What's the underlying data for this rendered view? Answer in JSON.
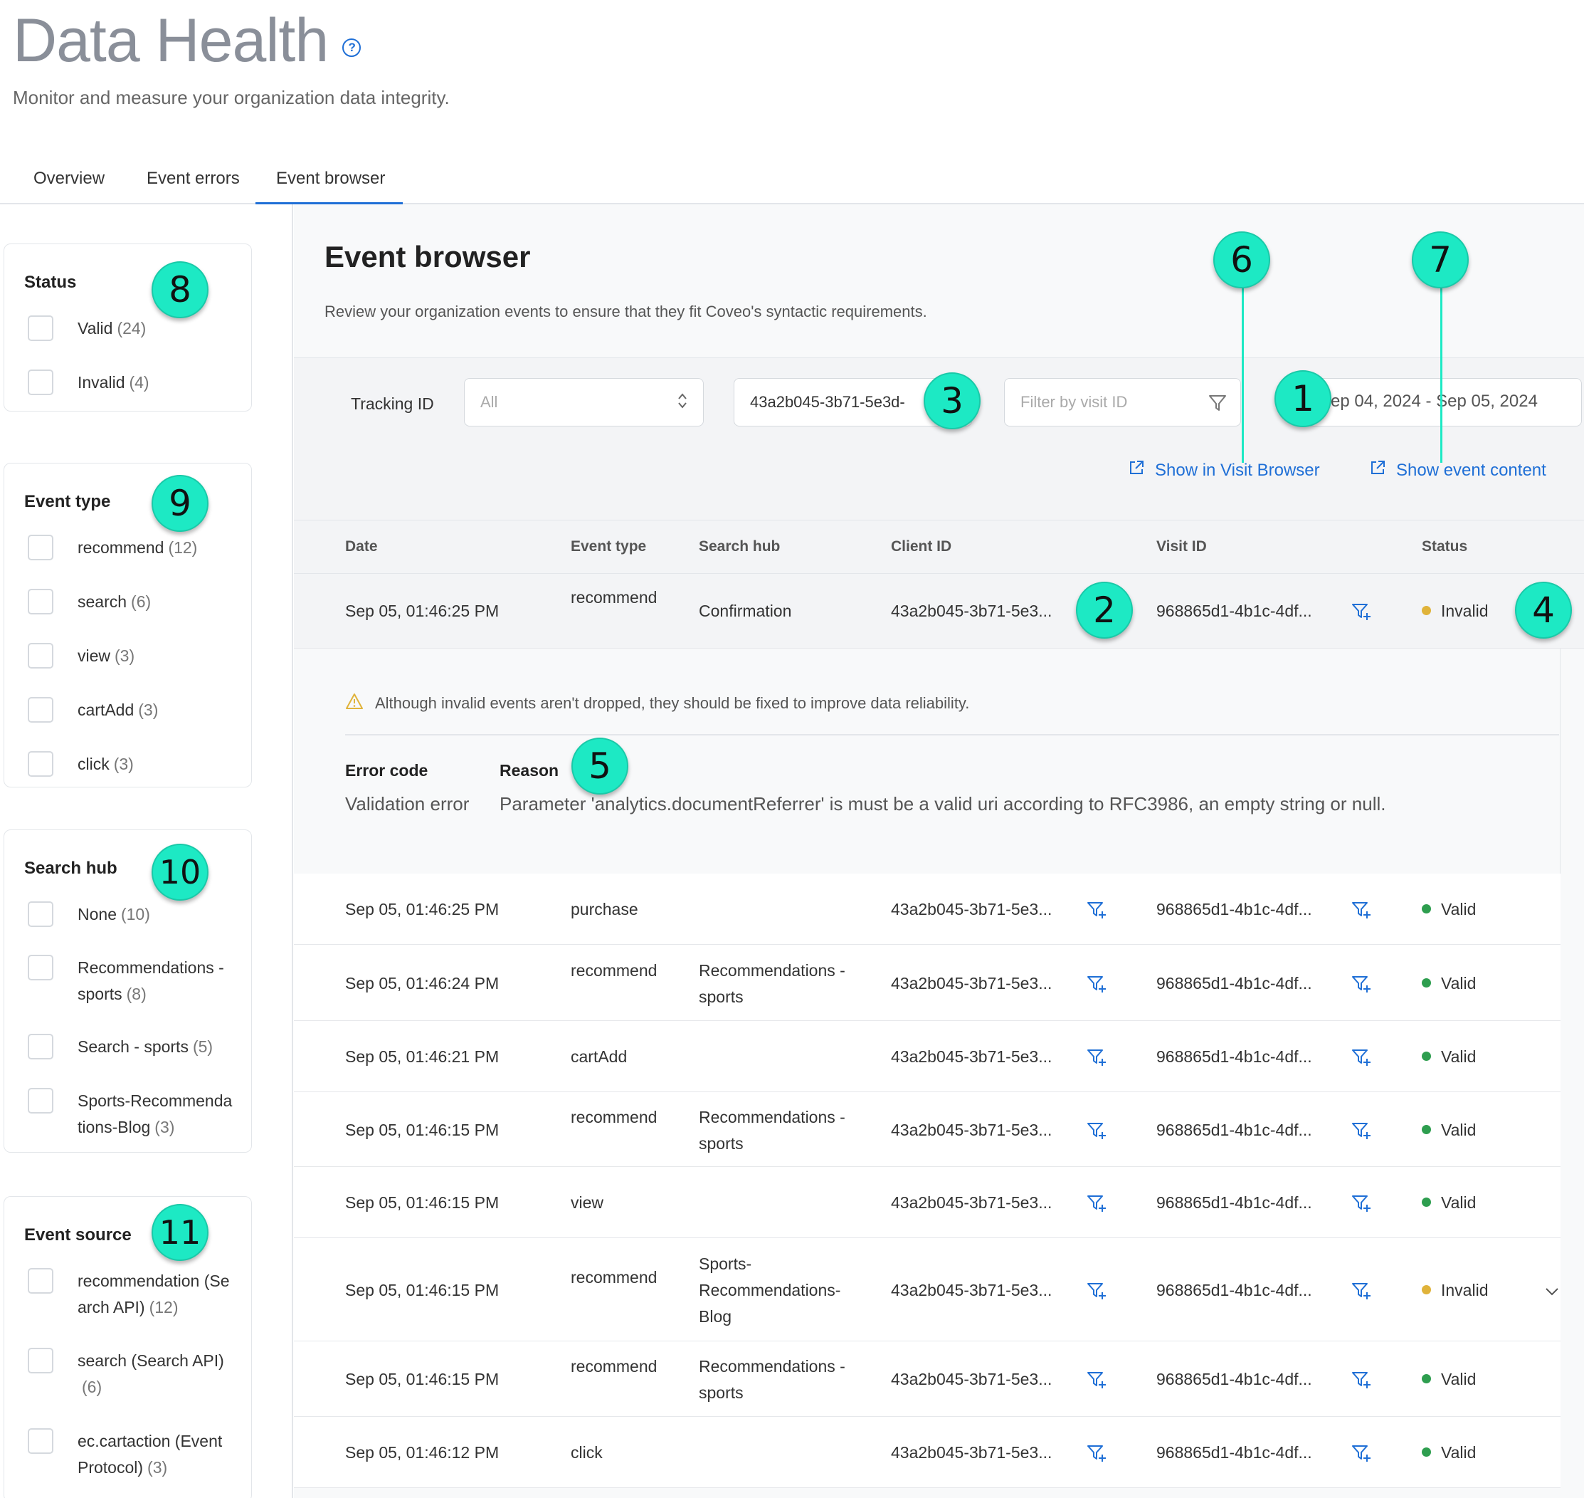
{
  "header": {
    "title": "Data Health",
    "help_icon": "?",
    "subtitle": "Monitor and measure your organization data integrity."
  },
  "tabs": [
    {
      "label": "Overview",
      "active": false
    },
    {
      "label": "Event errors",
      "active": false
    },
    {
      "label": "Event browser",
      "active": true
    }
  ],
  "facets": {
    "status": {
      "title": "Status",
      "items": [
        {
          "label": "Valid",
          "count": "(24)"
        },
        {
          "label": "Invalid",
          "count": "(4)"
        }
      ]
    },
    "event_type": {
      "title": "Event type",
      "items": [
        {
          "label": "recommend",
          "count": "(12)"
        },
        {
          "label": "search",
          "count": "(6)"
        },
        {
          "label": "view",
          "count": "(3)"
        },
        {
          "label": "cartAdd",
          "count": "(3)"
        },
        {
          "label": "click",
          "count": "(3)"
        }
      ]
    },
    "search_hub": {
      "title": "Search hub",
      "items": [
        {
          "label": "None",
          "count": "(10)"
        },
        {
          "label": "Recommendations - sports",
          "count": "(8)"
        },
        {
          "label": "Search - sports",
          "count": "(5)"
        },
        {
          "label": "Sports-Recommendations-Blog",
          "count": "(3)"
        }
      ]
    },
    "event_source": {
      "title": "Event source",
      "items": [
        {
          "label": "recommendation (Search API)",
          "count": "(12)"
        },
        {
          "label": "search (Search API)",
          "count": "(6)"
        },
        {
          "label": "ec.cartaction (Event Protocol)",
          "count": "(3)"
        }
      ]
    }
  },
  "main": {
    "title": "Event browser",
    "description": "Review your organization events to ensure that they fit Coveo's syntactic requirements."
  },
  "toolbar": {
    "tracking_label": "Tracking ID",
    "tracking_value": "All",
    "client_id_value": "43a2b045-3b71-5e3d-",
    "visit_placeholder": "Filter by visit ID",
    "date_range": "Sep 04, 2024 - Sep 05, 2024",
    "show_visit_browser": "Show in Visit Browser",
    "show_event_content": "Show event content"
  },
  "table": {
    "headers": [
      "Date",
      "Event type",
      "Search hub",
      "Client ID",
      "Visit ID",
      "Status"
    ],
    "rows": [
      {
        "date": "Sep 05, 01:46:25 PM",
        "type": "recommend",
        "hub": "Confirmation",
        "client": "43a2b045-3b71-5e3...",
        "visit": "968865d1-4b1c-4df...",
        "status": "Invalid"
      },
      {
        "date": "Sep 05, 01:46:25 PM",
        "type": "purchase",
        "hub": "",
        "client": "43a2b045-3b71-5e3...",
        "visit": "968865d1-4b1c-4df...",
        "status": "Valid"
      },
      {
        "date": "Sep 05, 01:46:24 PM",
        "type": "recommend",
        "hub": "Recommendations - sports",
        "client": "43a2b045-3b71-5e3...",
        "visit": "968865d1-4b1c-4df...",
        "status": "Valid"
      },
      {
        "date": "Sep 05, 01:46:21 PM",
        "type": "cartAdd",
        "hub": "",
        "client": "43a2b045-3b71-5e3...",
        "visit": "968865d1-4b1c-4df...",
        "status": "Valid"
      },
      {
        "date": "Sep 05, 01:46:15 PM",
        "type": "recommend",
        "hub": "Recommendations - sports",
        "client": "43a2b045-3b71-5e3...",
        "visit": "968865d1-4b1c-4df...",
        "status": "Valid"
      },
      {
        "date": "Sep 05, 01:46:15 PM",
        "type": "view",
        "hub": "",
        "client": "43a2b045-3b71-5e3...",
        "visit": "968865d1-4b1c-4df...",
        "status": "Valid"
      },
      {
        "date": "Sep 05, 01:46:15 PM",
        "type": "recommend",
        "hub": "Sports-Recommendations-Blog",
        "client": "43a2b045-3b71-5e3...",
        "visit": "968865d1-4b1c-4df...",
        "status": "Invalid"
      },
      {
        "date": "Sep 05, 01:46:15 PM",
        "type": "recommend",
        "hub": "Recommendations - sports",
        "client": "43a2b045-3b71-5e3...",
        "visit": "968865d1-4b1c-4df...",
        "status": "Valid"
      },
      {
        "date": "Sep 05, 01:46:12 PM",
        "type": "click",
        "hub": "",
        "client": "43a2b045-3b71-5e3...",
        "visit": "968865d1-4b1c-4df...",
        "status": "Valid"
      }
    ]
  },
  "details": {
    "warning": "Although invalid events aren't dropped, they should be fixed to improve data reliability.",
    "error_code_header": "Error code",
    "reason_header": "Reason",
    "error_code": "Validation error",
    "reason": "Parameter 'analytics.documentReferrer' is must be a valid uri according to RFC3986, an empty string or null."
  },
  "callouts": [
    "1",
    "2",
    "3",
    "4",
    "5",
    "6",
    "7",
    "8",
    "9",
    "10",
    "11"
  ],
  "colors": {
    "accent": "#1f6fd6",
    "callout": "#1de9c4",
    "valid": "#2e9e4f",
    "invalid": "#e0b33a"
  }
}
